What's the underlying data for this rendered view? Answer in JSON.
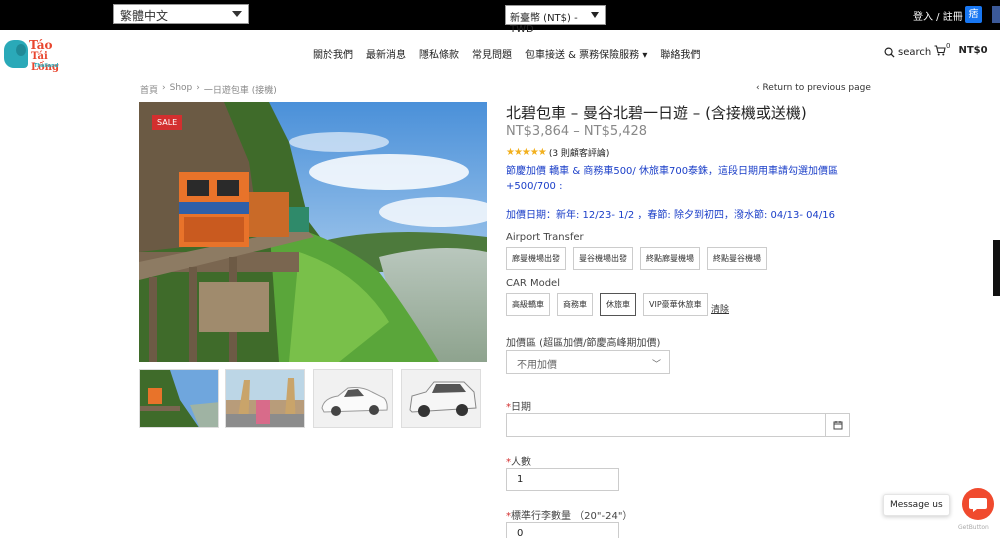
{
  "topbar": {
    "language": "繁體中文",
    "currency": "新臺幣 (NT$) - TWD",
    "login": "登入 / 註冊",
    "social_badge": "痞"
  },
  "logo": {
    "line1": "Táo",
    "line2": "Tái Lồng",
    "line3": "Thailand"
  },
  "nav": {
    "items": [
      "關於我們",
      "最新消息",
      "隱私條款",
      "常見問題",
      "包車接送 & 票務保險服務 ▾",
      "聯絡我們"
    ]
  },
  "header": {
    "search_label": "search",
    "cart_count": "0",
    "cart_total": "NT$0"
  },
  "breadcrumb": {
    "items": [
      "首頁",
      "Shop",
      "一日遊包車 (接機)"
    ],
    "separator": "›",
    "return_link": "‹ Return to previous page"
  },
  "product": {
    "sale_badge": "SALE",
    "title": "北碧包車 – 曼谷北碧一日遊 – (含接機或送機)",
    "price": "NT$3,864 – NT$5,428",
    "stars": "★★★★★",
    "reviews": "(3 則顧客評論)",
    "promo1": "節慶加價 轎車 & 商務車500/ 休旅車700泰銖，這段日期用車請勾選加價區+500/700 :",
    "promo2": "加價日期：新年: 12/23- 1/2 ，春節: 除夕到初四，潑水節: 04/13- 04/16"
  },
  "airport": {
    "label": "Airport Transfer",
    "options": [
      "廊曼機場出發",
      "曼谷機場出發",
      "終點廊曼機場",
      "終點曼谷機場"
    ]
  },
  "car": {
    "label": "CAR Model",
    "options": [
      "高級轎車",
      "商務車",
      "休旅車",
      "VIP豪華休旅車"
    ],
    "selected_index": 2,
    "clear": "清除"
  },
  "surcharge": {
    "label": "加價區 (超區加價/節慶高峰期加價)",
    "value": "不用加價",
    "chevron": "﹀"
  },
  "date_field": {
    "required_mark": "*",
    "label": "日期",
    "icon": "calendar-icon"
  },
  "people_field": {
    "required_mark": "*",
    "label": "人數",
    "value": "1"
  },
  "luggage_field": {
    "required_mark": "*",
    "label": "標準行李數量 （20\"-24\"）",
    "value": "0"
  },
  "widgets": {
    "message": "Message us",
    "getbutton": "GetButton"
  },
  "colors": {
    "accent_blue": "#1a3ec8",
    "sale_red": "#d32f2f",
    "star": "#f2b01e",
    "chat": "#f04a2e"
  }
}
